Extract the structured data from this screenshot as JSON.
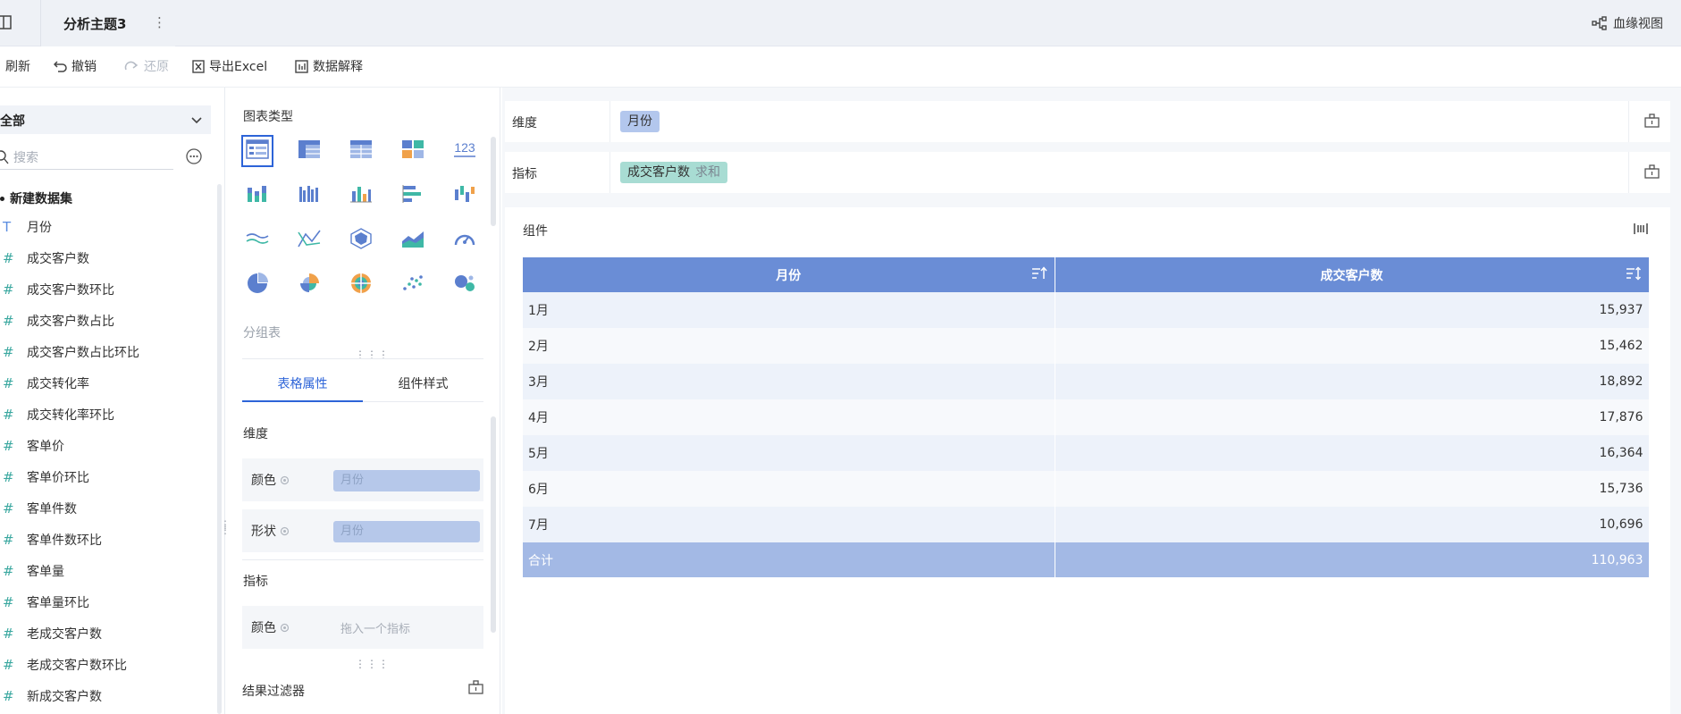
{
  "topbar": {
    "tab_title": "分析主题3",
    "tab_more": "⋮",
    "lineage_label": "血缘视图"
  },
  "toolbar": {
    "refresh": "刷新",
    "undo": "撤销",
    "redo": "还原",
    "export": "导出Excel",
    "explain": "数据解释"
  },
  "left": {
    "scope": "全部",
    "search_placeholder": "搜索",
    "dataset": "新建数据集",
    "fields": [
      {
        "type": "text",
        "icon": "T",
        "name": "月份"
      },
      {
        "type": "number",
        "icon": "#",
        "name": "成交客户数"
      },
      {
        "type": "number",
        "icon": "#",
        "name": "成交客户数环比"
      },
      {
        "type": "number",
        "icon": "#",
        "name": "成交客户数占比"
      },
      {
        "type": "number",
        "icon": "#",
        "name": "成交客户数占比环比"
      },
      {
        "type": "number",
        "icon": "#",
        "name": "成交转化率"
      },
      {
        "type": "number",
        "icon": "#",
        "name": "成交转化率环比"
      },
      {
        "type": "number",
        "icon": "#",
        "name": "客单价"
      },
      {
        "type": "number",
        "icon": "#",
        "name": "客单价环比"
      },
      {
        "type": "number",
        "icon": "#",
        "name": "客单件数"
      },
      {
        "type": "number",
        "icon": "#",
        "name": "客单件数环比"
      },
      {
        "type": "number",
        "icon": "#",
        "name": "客单量"
      },
      {
        "type": "number",
        "icon": "#",
        "name": "客单量环比"
      },
      {
        "type": "number",
        "icon": "#",
        "name": "老成交客户数"
      },
      {
        "type": "number",
        "icon": "#",
        "name": "老成交客户数环比"
      },
      {
        "type": "number",
        "icon": "#",
        "name": "新成交客户数"
      }
    ]
  },
  "mid": {
    "chart_type_title": "图表类型",
    "chart_types": [
      "grouped-table-icon",
      "cross-table-icon",
      "detail-table-icon",
      "mixed-chart-icon",
      "kpi-card-icon",
      "stacked-column-icon",
      "multi-series-column-icon",
      "column-chart-icon",
      "bar-chart-icon",
      "range-column-icon",
      "line-chart-icon",
      "multi-line-icon",
      "radar-chart-icon",
      "area-chart-icon",
      "gauge-chart-icon",
      "pie-chart-icon",
      "rose-chart-icon",
      "multi-pie-icon",
      "scatter-chart-icon",
      "bubble-chart-icon"
    ],
    "kpi_label": "123",
    "selected_chart": "分组表",
    "tab_table_props": "表格属性",
    "tab_component_style": "组件样式",
    "dimension_title": "维度",
    "color_label": "颜色",
    "shape_label": "形状",
    "dim_color_value": "月份",
    "dim_shape_value": "月份",
    "measure_title": "指标",
    "measure_color_placeholder": "拖入一个指标",
    "result_filter": "结果过滤器"
  },
  "shelves": {
    "dimension_label": "维度",
    "dimension_pill": "月份",
    "measure_label": "指标",
    "measure_pill": "成交客户数",
    "measure_agg": "求和"
  },
  "component": {
    "title": "组件",
    "columns": [
      "月份",
      "成交客户数"
    ],
    "rows": [
      {
        "month": "1月",
        "value": "15,937"
      },
      {
        "month": "2月",
        "value": "15,462"
      },
      {
        "month": "3月",
        "value": "18,892"
      },
      {
        "month": "4月",
        "value": "17,876"
      },
      {
        "month": "5月",
        "value": "16,364"
      },
      {
        "month": "6月",
        "value": "15,736"
      },
      {
        "month": "7月",
        "value": "10,696"
      }
    ],
    "total_label": "合计",
    "total_value": "110,963"
  },
  "colors": {
    "accent": "#2d64d8",
    "header_blue": "#6a8dd6",
    "total_row": "#a3b9e5",
    "dimension_pill": "#b3c7ed",
    "measure_pill": "#a8dcd3",
    "number_field": "#3ba8a0"
  }
}
